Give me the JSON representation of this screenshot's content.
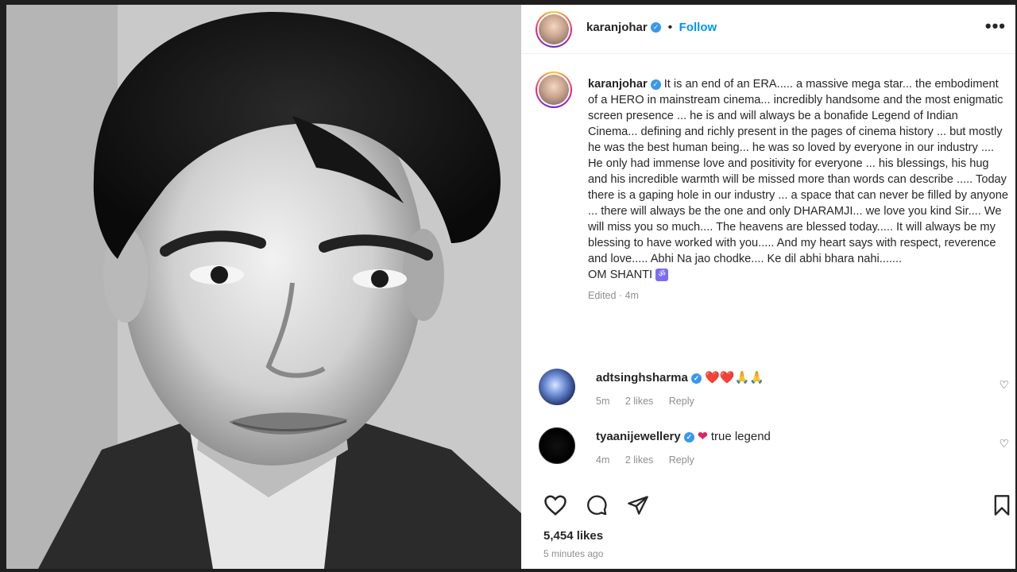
{
  "post": {
    "author": "karanjohar",
    "follow_label": "Follow",
    "more_label": "•••",
    "caption_body": "It is an end of an ERA..... a massive mega star... the embodiment of a HERO in mainstream cinema... incredibly handsome and the most enigmatic screen presence ... he is and will always be a bonafide Legend of Indian Cinema... defining and richly present in the pages of cinema history ... but mostly he was the best human being... he was so loved by everyone in our industry .... He only had immense love and positivity for everyone ... his blessings, his hug and his incredible warmth will be missed more than words can describe ..... Today there is a gaping hole in our industry ... a space that can never be filled by anyone ... there will always be the one and only DHARAMJI... we love you kind Sir.... We will miss you so much.... The heavens are blessed today..... It will always be my blessing to have worked with you..... And my heart says with respect, reverence and love..... Abhi Na jao chodke.... Ke dil abhi bhara nahi.......",
    "caption_closing": "OM SHANTI",
    "caption_meta": "Edited · 4m",
    "likes": "5,454 likes",
    "posted_time": "5 minutes ago"
  },
  "comments": [
    {
      "username": "adtsinghsharma",
      "text": "❤️❤️🙏🙏",
      "age": "5m",
      "likes": "2 likes",
      "reply": "Reply"
    },
    {
      "username": "tyaanijewellery",
      "text": "true legend",
      "age": "4m",
      "likes": "2 likes",
      "reply": "Reply"
    }
  ],
  "icons": {
    "like": "heart-icon",
    "comment": "comment-icon",
    "share": "send-icon",
    "save": "bookmark-icon"
  },
  "colors": {
    "accent": "#0095f6",
    "verified": "#3897f0",
    "text": "#262626",
    "muted": "#8e8e8e"
  }
}
